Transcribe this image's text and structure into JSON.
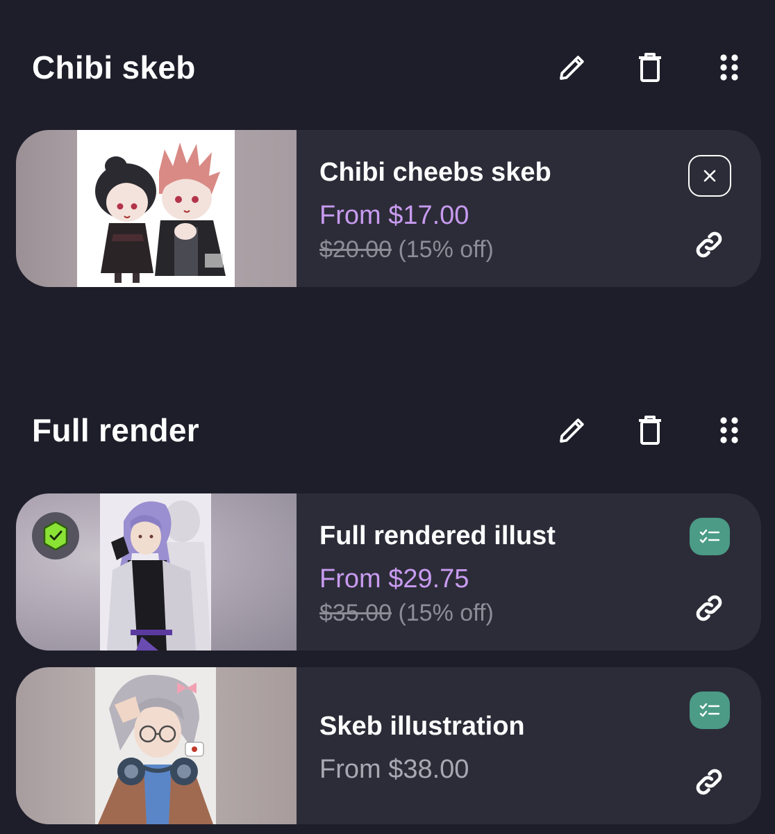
{
  "sections": [
    {
      "title": "Chibi skeb",
      "items": [
        {
          "name": "Chibi cheebs skeb",
          "price": "From $17.00",
          "old_price": "$20.00",
          "discount": "(15% off)"
        }
      ]
    },
    {
      "title": "Full render",
      "items": [
        {
          "name": "Full rendered illust",
          "price": "From $29.75",
          "old_price": "$35.00",
          "discount": "(15% off)"
        },
        {
          "name": "Skeb illustration",
          "price": "From $38.00"
        }
      ]
    }
  ],
  "colors": {
    "background": "#1e1e2a",
    "card": "#2c2c38",
    "discounted_price": "#c89bf0",
    "regular_price": "#a9a9b3",
    "muted": "#8d8d98",
    "accent_teal": "#4b9b86",
    "badge_green": "#8ae234"
  },
  "icons": {
    "edit": "pencil-icon",
    "delete": "trash-icon",
    "reorder": "drag-handle-icon",
    "remove": "close-icon",
    "checklist": "checklist-icon",
    "link": "link-icon",
    "verified": "verified-badge-icon"
  }
}
